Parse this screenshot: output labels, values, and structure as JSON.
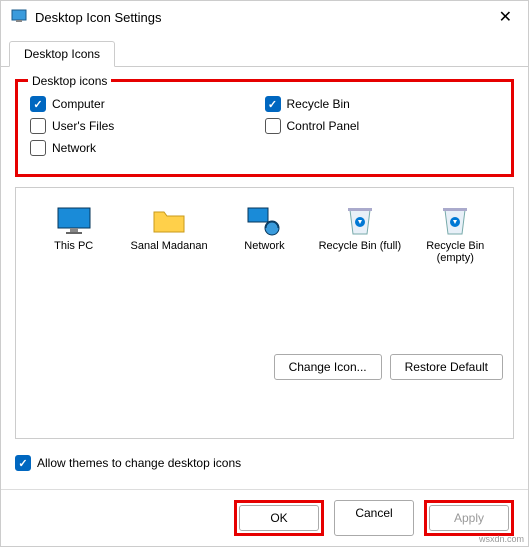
{
  "window": {
    "title": "Desktop Icon Settings"
  },
  "tabs": [
    "Desktop Icons"
  ],
  "group": {
    "legend": "Desktop icons",
    "left": [
      {
        "label": "Computer",
        "checked": true
      },
      {
        "label": "User's Files",
        "checked": false
      },
      {
        "label": "Network",
        "checked": false
      }
    ],
    "right": [
      {
        "label": "Recycle Bin",
        "checked": true
      },
      {
        "label": "Control Panel",
        "checked": false
      }
    ]
  },
  "icons": [
    {
      "name": "This PC",
      "type": "monitor"
    },
    {
      "name": "Sanal Madanan",
      "type": "folder"
    },
    {
      "name": "Network",
      "type": "network"
    },
    {
      "name": "Recycle Bin (full)",
      "type": "bin-full"
    },
    {
      "name": "Recycle Bin (empty)",
      "type": "bin-empty"
    }
  ],
  "buttons": {
    "changeIcon": "Change Icon...",
    "restoreDefault": "Restore Default",
    "allowThemes": "Allow themes to change desktop icons",
    "ok": "OK",
    "cancel": "Cancel",
    "apply": "Apply"
  },
  "allowThemesChecked": true,
  "watermark": "wsxdn.com"
}
